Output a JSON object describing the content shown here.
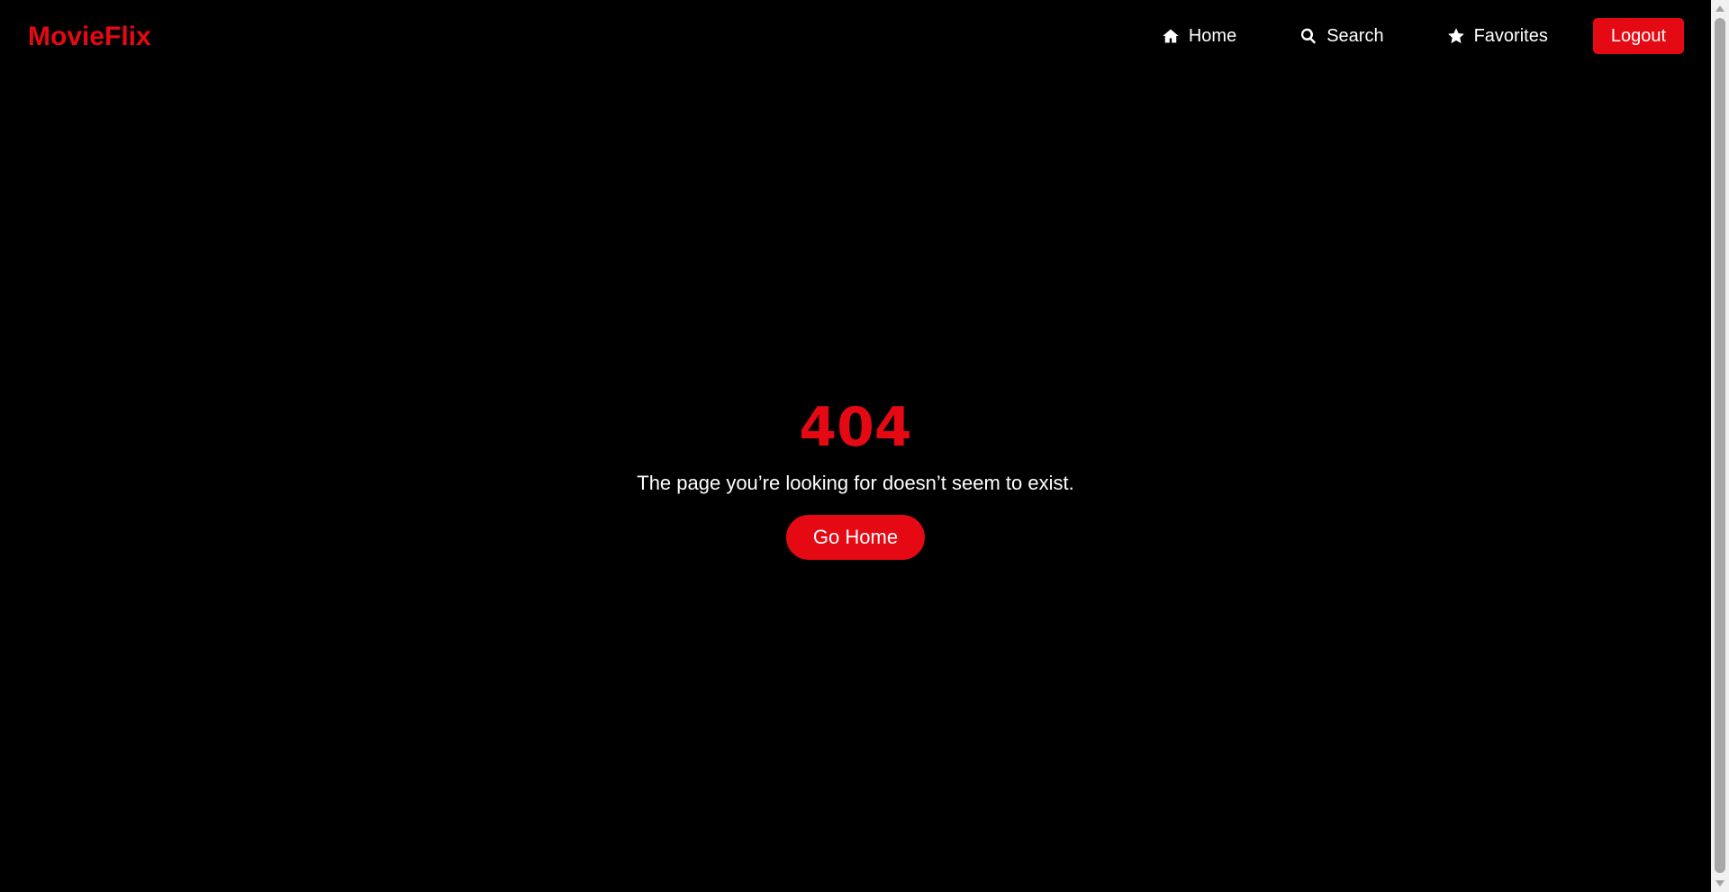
{
  "navbar": {
    "logo": "MovieFlix",
    "links": [
      {
        "label": "Home",
        "icon": "home-icon"
      },
      {
        "label": "Search",
        "icon": "search-icon"
      },
      {
        "label": "Favorites",
        "icon": "star-icon"
      }
    ],
    "logout_label": "Logout"
  },
  "error": {
    "code": "404",
    "message": "The page you’re looking for doesn’t seem to exist.",
    "button_label": "Go Home"
  },
  "colors": {
    "accent": "#e50914",
    "background": "#000000",
    "text": "#ffffff"
  }
}
